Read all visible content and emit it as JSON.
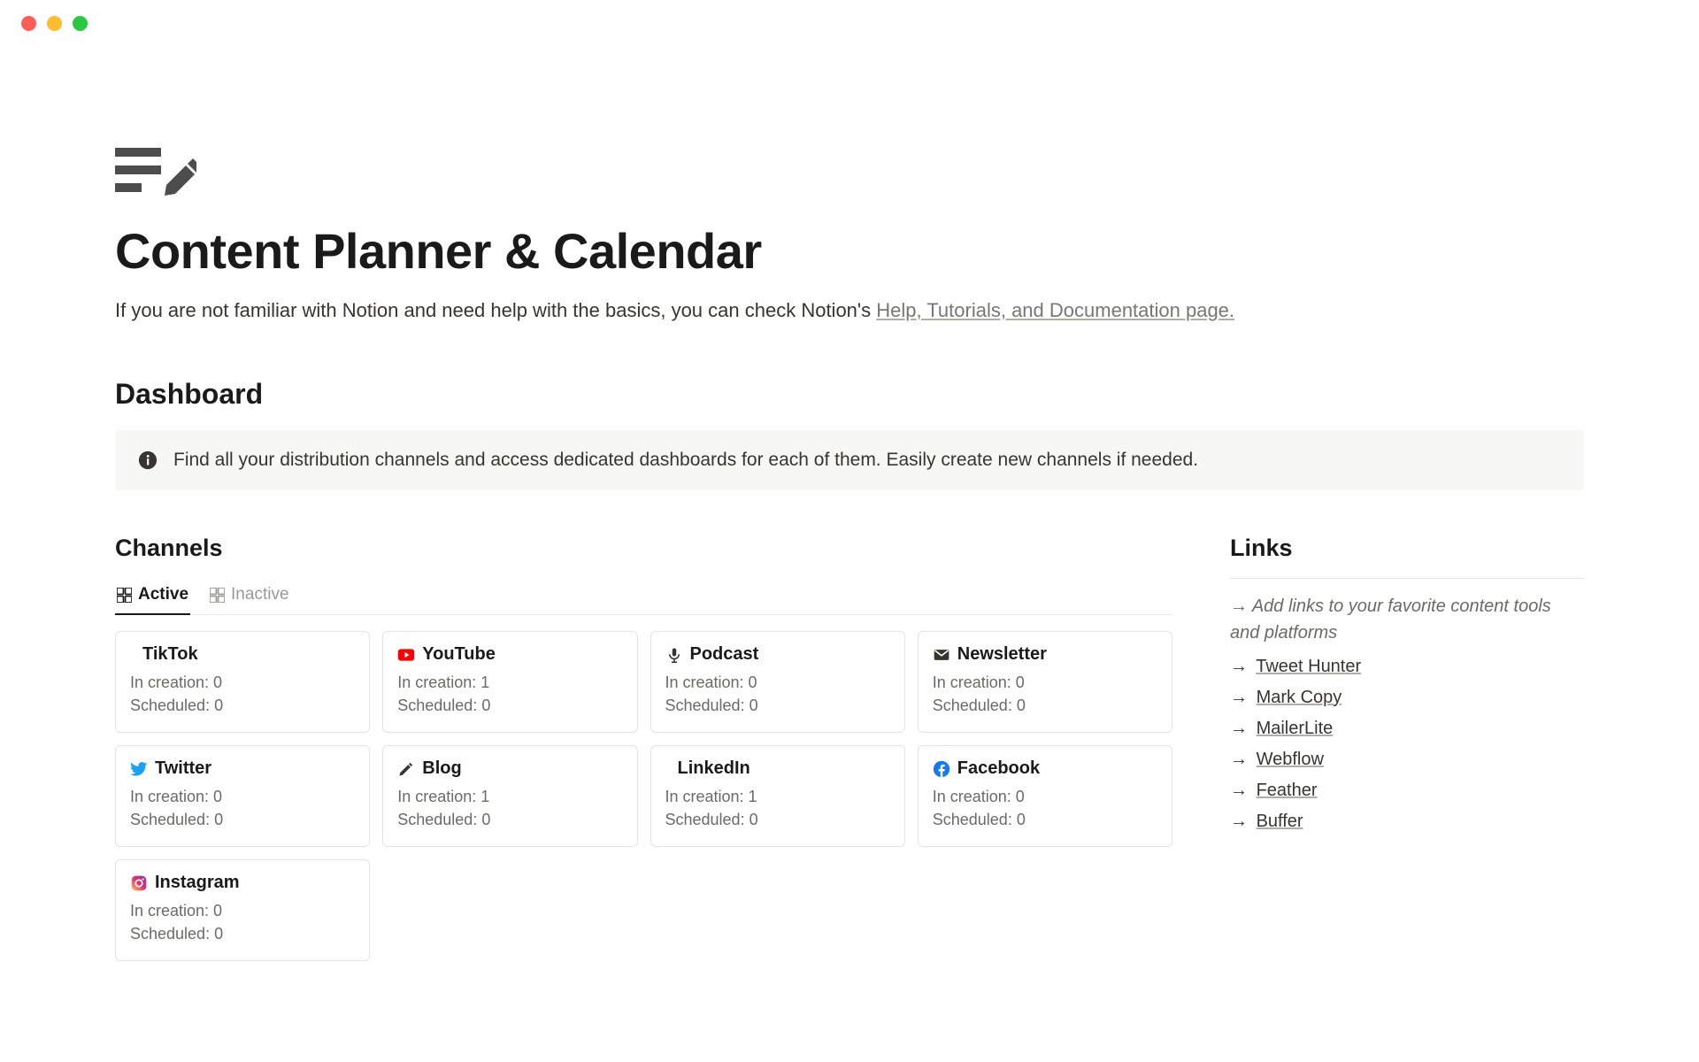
{
  "page": {
    "title": "Content Planner & Calendar",
    "intro_prefix": "If you are not familiar with Notion and need help with the basics, you can check Notion's ",
    "intro_link": "Help, Tutorials, and Documentation page."
  },
  "dashboard": {
    "heading": "Dashboard",
    "callout": "Find all your distribution channels and access dedicated dashboards for each of them. Easily create new channels if needed."
  },
  "channels": {
    "heading": "Channels",
    "tabs": {
      "active": "Active",
      "inactive": "Inactive"
    },
    "stat_labels": {
      "in_creation": "In creation: ",
      "scheduled": "Scheduled: "
    },
    "items": [
      {
        "name": "TikTok",
        "in_creation": 0,
        "scheduled": 0,
        "icon": "tiktok"
      },
      {
        "name": "YouTube",
        "in_creation": 1,
        "scheduled": 0,
        "icon": "youtube"
      },
      {
        "name": "Podcast",
        "in_creation": 0,
        "scheduled": 0,
        "icon": "podcast"
      },
      {
        "name": "Newsletter",
        "in_creation": 0,
        "scheduled": 0,
        "icon": "newsletter"
      },
      {
        "name": "Twitter",
        "in_creation": 0,
        "scheduled": 0,
        "icon": "twitter"
      },
      {
        "name": "Blog",
        "in_creation": 1,
        "scheduled": 0,
        "icon": "blog"
      },
      {
        "name": "LinkedIn",
        "in_creation": 1,
        "scheduled": 0,
        "icon": "linkedin"
      },
      {
        "name": "Facebook",
        "in_creation": 0,
        "scheduled": 0,
        "icon": "facebook"
      },
      {
        "name": "Instagram",
        "in_creation": 0,
        "scheduled": 0,
        "icon": "instagram"
      }
    ]
  },
  "links": {
    "heading": "Links",
    "hint": "Add links to your favorite content tools and platforms",
    "arrow": "→",
    "items": [
      "Tweet Hunter",
      "Mark Copy",
      "MailerLite",
      "Webflow",
      "Feather",
      "Buffer"
    ]
  }
}
